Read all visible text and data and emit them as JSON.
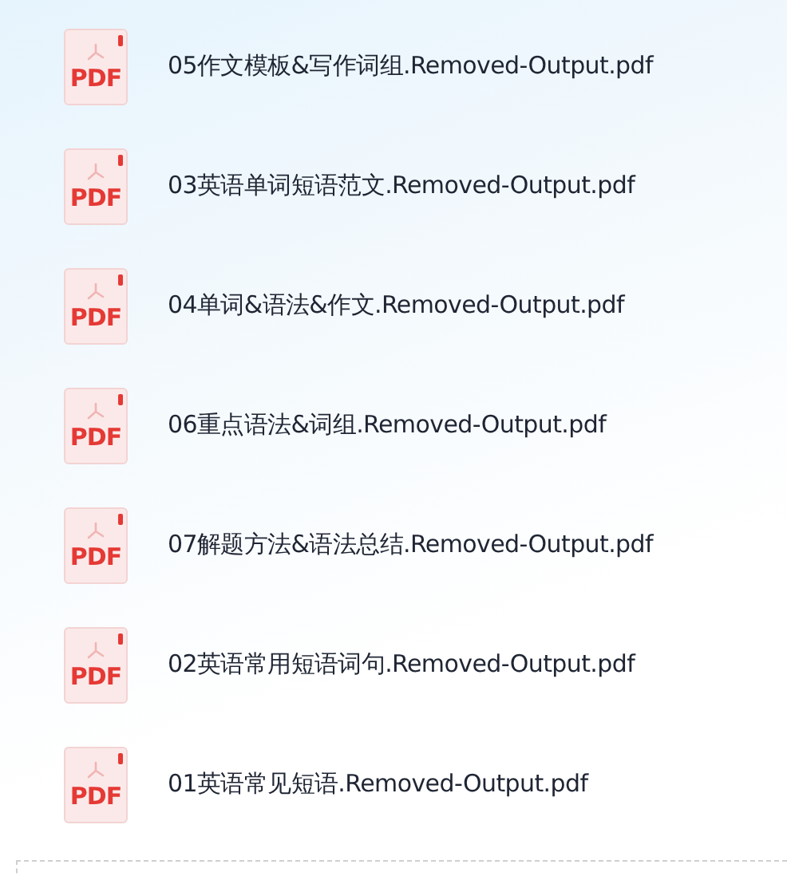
{
  "files": [
    {
      "name": "05作文模板&写作词组.Removed-Output.pdf",
      "icon_label": "PDF"
    },
    {
      "name": "03英语单词短语范文.Removed-Output.pdf",
      "icon_label": "PDF"
    },
    {
      "name": "04单词&语法&作文.Removed-Output.pdf",
      "icon_label": "PDF"
    },
    {
      "name": "06重点语法&词组.Removed-Output.pdf",
      "icon_label": "PDF"
    },
    {
      "name": "07解题方法&语法总结.Removed-Output.pdf",
      "icon_label": "PDF"
    },
    {
      "name": "02英语常用短语词句.Removed-Output.pdf",
      "icon_label": "PDF"
    },
    {
      "name": "01英语常见短语.Removed-Output.pdf",
      "icon_label": "PDF"
    }
  ]
}
